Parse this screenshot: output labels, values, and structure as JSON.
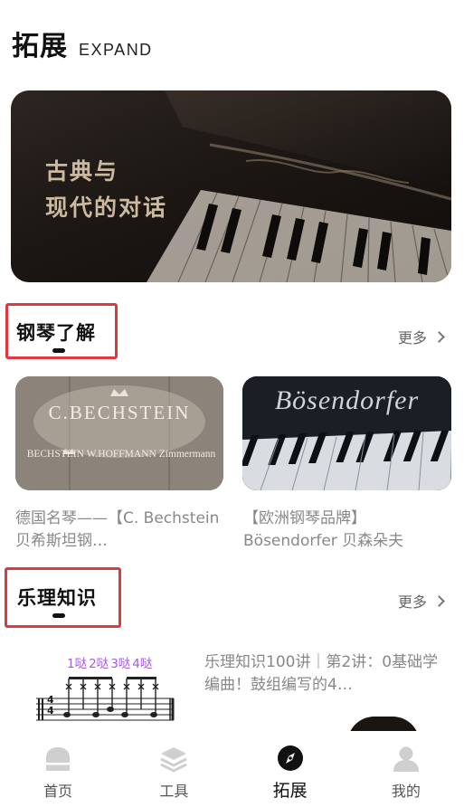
{
  "header": {
    "title": "拓展",
    "subtitle": "EXPAND"
  },
  "banner": {
    "text": "古典与\n现代的对话"
  },
  "section_piano": {
    "title": "钢琴了解",
    "more": "更多",
    "cards": [
      {
        "brand_lines": [
          "C.BECHSTEIN",
          "BECHSTEIN W.HOFFMANN Zimmermann"
        ],
        "caption": "德国名琴——【C. Bechstein 贝希斯坦钢…"
      },
      {
        "brand_lines": [
          "Bösendorfer"
        ],
        "caption": "【欧洲钢琴品牌】Bösendorfer 贝森朵夫"
      }
    ]
  },
  "section_theory": {
    "title": "乐理知识",
    "more": "更多",
    "lesson": {
      "thumb_labels": [
        "1哒",
        "2哒",
        "3哒",
        "4哒"
      ],
      "time_sig": [
        "4",
        "4"
      ],
      "text": "乐理知识100讲｜第2讲：0基础学编曲！鼓组编写的4…"
    }
  },
  "tabbar": {
    "items": [
      {
        "label": "首页",
        "icon": "home-icon"
      },
      {
        "label": "工具",
        "icon": "tools-layers-icon"
      },
      {
        "label": "拓展",
        "icon": "compass-icon",
        "active": true
      },
      {
        "label": "我的",
        "icon": "user-icon"
      }
    ]
  },
  "colors": {
    "highlight_border": "#e0383e",
    "banner_text": "#cbb9a0",
    "muted_text": "#888888"
  }
}
